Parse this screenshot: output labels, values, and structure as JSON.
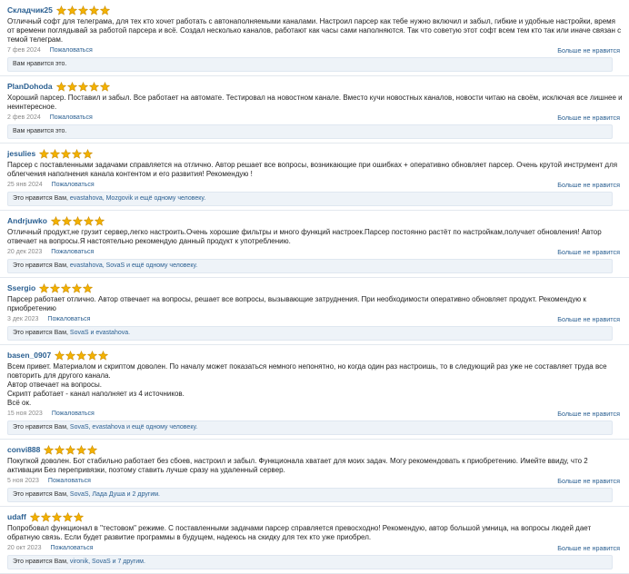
{
  "labels": {
    "complain": "Пожаловаться",
    "dislike": "Больше не нравится"
  },
  "colors": {
    "star_fill": "#f3b200",
    "star_stroke": "#c98a00",
    "link": "#2a5f91",
    "likes_bg": "#eef3f8"
  },
  "reviews": [
    {
      "author": "Складчик25",
      "rating": 5,
      "text": "Отличный софт для телеграма, для тех кто хочет работать с автонаполняемыми каналами. Настроил парсер как тебе нужно включил и забыл, гибкие и удобные настройки, время от времени поглядывай за работой парсера и всё. Создал несколько каналов, работают как часы сами наполняются. Так что советую этот софт всем тем кто так или иначе связан с темой телеграм.",
      "date": "7 фев 2024",
      "likes_prefix": "Вам нравится это.",
      "likes_names": ""
    },
    {
      "author": "PlanDohoda",
      "rating": 5,
      "text": "Хороший парсер. Поставил и забыл. Все работает на автомате. Тестировал на новостном канале. Вместо кучи новостных каналов, новости читаю на своём, исключая все лишнее и неинтересное.",
      "date": "2 фев 2024",
      "likes_prefix": "Вам нравится это.",
      "likes_names": ""
    },
    {
      "author": "jesulies",
      "rating": 5,
      "text": "Парсер с поставленными задачами справляется на отлично. Автор решает все вопросы, возникающие при ошибках + оперативно обновляет парсер. Очень крутой инструмент для облегчения наполнения канала контентом и его развития! Рекомендую !",
      "date": "25 янв 2024",
      "likes_prefix": "Это нравится Вам, ",
      "likes_names": "evastahova, Mozgovik и ещё одному человеку."
    },
    {
      "author": "Andrjuwko",
      "rating": 5,
      "text": "Отличный продукт,не грузит сервер,легко настроить.Очень хорошие фильтры и много функций настроек.Парсер постоянно растёт по настройкам,получает обновления! Автор отвечает на вопросы.Я настоятельно рекомендую данный продукт к употреблению.",
      "date": "20 дек 2023",
      "likes_prefix": "Это нравится Вам, ",
      "likes_names": "evastahova, SovaS и ещё одному человеку."
    },
    {
      "author": "Ssergio",
      "rating": 5,
      "text": "Парсер работает отлично. Автор отвечает на вопросы, решает все вопросы, вызывающие затруднения. При необходимости оперативно обновляет продукт. Рекомендую к приобретению",
      "date": "3 дек 2023",
      "likes_prefix": "Это нравится Вам, ",
      "likes_names": "SovaS и evastahova."
    },
    {
      "author": "basen_0907",
      "rating": 5,
      "text": "Всем привет. Материалом и скриптом доволен. По началу может показаться немного непонятно, но когда один раз настроишь, то в следующий раз уже не составляет труда все повторить для другого канала.\nАвтор отвечает на вопросы.\nСкрипт работает - канал наполняет из 4 источников.\nВсё ок.",
      "date": "15 ноя 2023",
      "likes_prefix": "Это нравится Вам, ",
      "likes_names": "SovaS, evastahova и ещё одному человеку."
    },
    {
      "author": "convi888",
      "rating": 5,
      "text": "Покупкой доволен. Бот стабильно работает без сбоев, настроил и забыл. Функционала хватает для моих задач. Могу рекомендовать к приобретению. Имейте ввиду, что 2 активации Без перепривязки, поэтому ставить лучше сразу на удаленный сервер.",
      "date": "5 ноя 2023",
      "likes_prefix": "Это нравится Вам, ",
      "likes_names": "SovaS, Лада Душа и 2 другим."
    },
    {
      "author": "udaff",
      "rating": 5,
      "text": "Попробовал функционал в \"тестовом\" режиме. С поставленными задачами парсер справляется превосходно! Рекомендую, автор большой умница, на вопросы людей дает обратную связь. Если будет развитие программы в будущем, надеюсь на скидку для тех кто уже приобрел.",
      "date": "20 окт 2023",
      "likes_prefix": "Это нравится Вам, ",
      "likes_names": "vironik, SovaS и 7 другим."
    }
  ]
}
